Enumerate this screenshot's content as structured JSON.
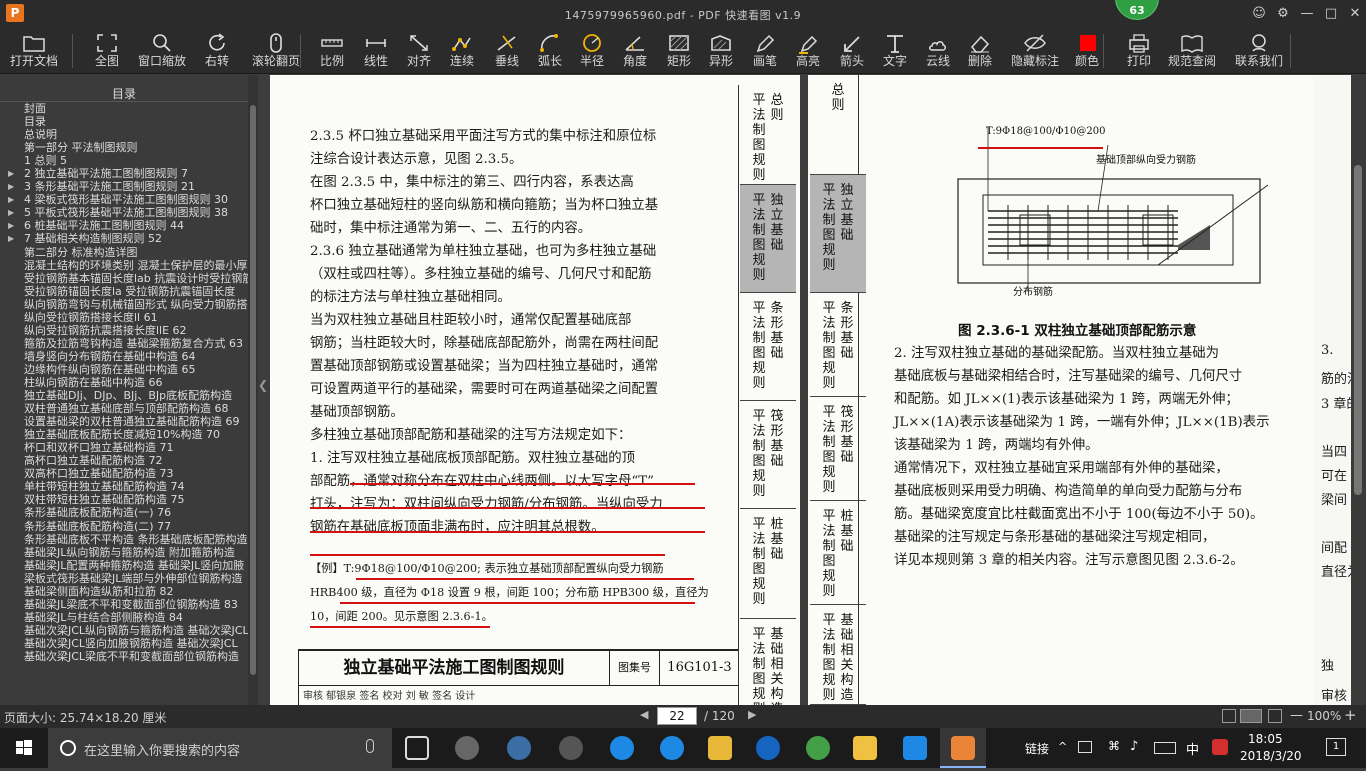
{
  "window": {
    "title": "1475979965960.pdf - PDF 快速看图 v1.9",
    "logo_letter": "P",
    "badge": "63"
  },
  "toolbar": [
    {
      "label": "打开文档",
      "icon": "folder-icon"
    },
    {
      "label": "全图",
      "icon": "fullscreen-icon"
    },
    {
      "label": "窗口缩放",
      "icon": "zoom-icon"
    },
    {
      "label": "右转",
      "icon": "rotate-right-icon"
    },
    {
      "label": "滚轮翻页",
      "icon": "mouse-icon"
    },
    {
      "label": "比例",
      "icon": "scale-icon"
    },
    {
      "label": "线性",
      "icon": "linear-icon"
    },
    {
      "label": "对齐",
      "icon": "align-icon"
    },
    {
      "label": "连续",
      "icon": "continuous-icon"
    },
    {
      "label": "垂线",
      "icon": "perpendicular-icon"
    },
    {
      "label": "弧长",
      "icon": "arc-icon"
    },
    {
      "label": "半径",
      "icon": "radius-icon"
    },
    {
      "label": "角度",
      "icon": "angle-icon"
    },
    {
      "label": "矩形",
      "icon": "rectangle-icon"
    },
    {
      "label": "异形",
      "icon": "irregular-icon"
    },
    {
      "label": "画笔",
      "icon": "pen-icon"
    },
    {
      "label": "高亮",
      "icon": "highlight-icon"
    },
    {
      "label": "箭头",
      "icon": "arrow-icon"
    },
    {
      "label": "文字",
      "icon": "text-icon"
    },
    {
      "label": "云线",
      "icon": "cloud-icon"
    },
    {
      "label": "删除",
      "icon": "eraser-icon"
    },
    {
      "label": "隐藏标注",
      "icon": "eye-hidden-icon"
    },
    {
      "label": "颜色",
      "icon": "color-swatch-icon",
      "color": "#ff0000"
    },
    {
      "label": "打印",
      "icon": "print-icon"
    },
    {
      "label": "规范查阅",
      "icon": "book-icon"
    },
    {
      "label": "联系我们",
      "icon": "contact-icon"
    }
  ],
  "sidebar": {
    "title": "目录",
    "items": [
      {
        "text": "封面",
        "expandable": false
      },
      {
        "text": "目录",
        "expandable": false
      },
      {
        "text": "总说明",
        "expandable": false
      },
      {
        "text": "第一部分  平法制图规则",
        "expandable": false
      },
      {
        "text": "1 总则 5",
        "expandable": false
      },
      {
        "text": "2 独立基础平法施工图制图规则 7",
        "expandable": true
      },
      {
        "text": "3 条形基础平法施工图制图规则 21",
        "expandable": true
      },
      {
        "text": "4 梁板式筏形基础平法施工图制图规则 30",
        "expandable": true
      },
      {
        "text": "5 平板式筏形基础平法施工图制图规则 38",
        "expandable": true
      },
      {
        "text": "6 桩基础平法施工图制图规则 44",
        "expandable": true
      },
      {
        "text": "7 基础相关构造制图规则 52",
        "expandable": true
      },
      {
        "text": "第二部分  标准构造详图",
        "expandable": false
      },
      {
        "text": "混凝土结构的环境类别 混凝土保护层的最小厚度",
        "expandable": false
      },
      {
        "text": "受拉钢筋基本锚固长度lab 抗震设计时受拉钢筋",
        "expandable": false
      },
      {
        "text": "受拉钢筋锚固长度la 受拉钢筋抗震锚固长度",
        "expandable": false
      },
      {
        "text": "纵向钢筋弯钩与机械锚固形式 纵向受力钢筋搭接",
        "expandable": false
      },
      {
        "text": "纵向受拉钢筋搭接长度ll 61",
        "expandable": false
      },
      {
        "text": "纵向受拉钢筋抗震搭接长度llE 62",
        "expandable": false
      },
      {
        "text": "箍筋及拉筋弯钩构造 基础梁箍筋复合方式 63",
        "expandable": false
      },
      {
        "text": "墙身竖向分布钢筋在基础中构造 64",
        "expandable": false
      },
      {
        "text": "边缘构件纵向钢筋在基础中构造 65",
        "expandable": false
      },
      {
        "text": "柱纵向钢筋在基础中构造 66",
        "expandable": false
      },
      {
        "text": "独立基础DJj、DJp、BJj、BJp底板配筋构造",
        "expandable": false
      },
      {
        "text": "双柱普通独立基础底部与顶部配筋构造 68",
        "expandable": false
      },
      {
        "text": "设置基础梁的双柱普通独立基础配筋构造 69",
        "expandable": false
      },
      {
        "text": "独立基础底板配筋长度减短10%构造 70",
        "expandable": false
      },
      {
        "text": "杯口和双杯口独立基础构造 71",
        "expandable": false
      },
      {
        "text": "高杯口独立基础配筋构造 72",
        "expandable": false
      },
      {
        "text": "双高杯口独立基础配筋构造 73",
        "expandable": false
      },
      {
        "text": "单柱带短柱独立基础配筋构造 74",
        "expandable": false
      },
      {
        "text": "双柱带短柱独立基础配筋构造 75",
        "expandable": false
      },
      {
        "text": "条形基础底板配筋构造(一) 76",
        "expandable": false
      },
      {
        "text": "条形基础底板配筋构造(二) 77",
        "expandable": false
      },
      {
        "text": "条形基础底板不平构造 条形基础底板配筋构造",
        "expandable": false
      },
      {
        "text": "基础梁JL纵向钢筋与箍筋构造 附加箍筋构造",
        "expandable": false
      },
      {
        "text": "基础梁JL配置两种箍筋构造 基础梁JL竖向加腋",
        "expandable": false
      },
      {
        "text": "梁板式筏形基础梁JL端部与外伸部位钢筋构造",
        "expandable": false
      },
      {
        "text": "基础梁侧面构造纵筋和拉筋 82",
        "expandable": false
      },
      {
        "text": "基础梁JL梁底不平和变截面部位钢筋构造 83",
        "expandable": false
      },
      {
        "text": "基础梁JL与柱结合部侧腋构造 84",
        "expandable": false
      },
      {
        "text": "基础次梁JCL纵向钢筋与箍筋构造 基础次梁JCL",
        "expandable": false
      },
      {
        "text": "基础次梁JCL竖向加腋钢筋构造 基础次梁JCL",
        "expandable": false
      },
      {
        "text": "基础次梁JCL梁底不平和变截面部位钢筋构造",
        "expandable": false
      }
    ]
  },
  "page_left": {
    "paragraphs": [
      "2.3.5 杯口独立基础采用平面注写方式的集中标注和原位标",
      "注综合设计表达示意，见图 2.3.5。",
      "    在图 2.3.5 中，集中标注的第三、四行内容，系表达高",
      "杯口独立基础短柱的竖向纵筋和横向箍筋；当为杯口独立基",
      "础时，集中标注通常为第一、二、五行的内容。",
      "2.3.6 独立基础通常为单柱独立基础，也可为多柱独立基础",
      "（双柱或四柱等）。多柱独立基础的编号、几何尺寸和配筋",
      "的标注方法与单柱独立基础相同。",
      "    当为双柱独立基础且柱距较小时，通常仅配置基础底部",
      "钢筋；当柱距较大时，除基础底部配筋外，尚需在两柱间配",
      "置基础顶部钢筋或设置基础梁；当为四柱独立基础时，通常",
      "可设置两道平行的基础梁，需要时可在两道基础梁之间配置",
      "基础顶部钢筋。",
      "    多柱独立基础顶部配筋和基础梁的注写方法规定如下：",
      "    1. 注写双柱独立基础底板顶部配筋。双柱独立基础的顶",
      "部配筋，通常对称分布在双柱中心线两侧。以大写字母“T”",
      "打头，注写为：双柱间纵向受力钢筋/分布钢筋。当纵向受力",
      "钢筋在基础底板顶面非满布时，应注明其总根数。"
    ],
    "example_lines": [
      "【例】T:9Φ18@100/Φ10@200; 表示独立基础顶部配置纵向受力钢筋",
      "HRB400 级，直径为 Φ18 设置 9 根，间距 100；分布筋 HPB300 级，直径为",
      "10，间距 200。见示意图 2.3.6-1。"
    ],
    "title_block": {
      "title": "独立基础平法施工图制图规则",
      "label": "图集号",
      "code": "16G101-3",
      "review_row": "审核 郁银泉 签名 校对 刘 敏 签名 设计"
    },
    "side_tabs": [
      "平法制图规则 总则",
      "平法制图规则 独立基础",
      "平法制图规则 条形基础",
      "平法制图规则 筏形基础",
      "平法制图规则 桩基础",
      "平法制图规则 基础相关构造"
    ]
  },
  "page_right": {
    "side_tabs": [
      "总则",
      "平法制图规则 独立基础",
      "平法制图规则 条形基础",
      "平法制图规则 筏形基础",
      "平法制图规则 桩基础",
      "平法制图规则 基础相关构造"
    ],
    "figure": {
      "label_top": "T:9Φ18@100/Φ10@200",
      "label_rebar": "基础顶部纵向受力钢筋",
      "label_dist": "分布钢筋",
      "caption": "图 2.3.6-1  双柱独立基础顶部配筋示意"
    },
    "paragraphs": [
      "    2. 注写双柱独立基础的基础梁配筋。当双柱独立基础为",
      "基础底板与基础梁相结合时，注写基础梁的编号、几何尺寸",
      "和配筋。如 JL××(1)表示该基础梁为 1 跨，两端无外伸；",
      "JL××(1A)表示该基础梁为 1 跨，一端有外伸；JL××(1B)表示",
      "该基础梁为 1 跨，两端均有外伸。",
      "    通常情况下，双柱独立基础宜采用端部有外伸的基础梁，",
      "基础底板则采用受力明确、构造简单的单向受力配筋与分布",
      "筋。基础梁宽度宜比柱截面宽出不小于 100(每边不小于 50)。",
      "    基础梁的注写规定与条形基础的基础梁注写规定相同，",
      "详见本规则第 3 章的相关内容。注写示意图见图 2.3.6-2。"
    ],
    "peek_lines": [
      "3.",
      "筋的注",
      "3 章的",
      "当四",
      "可在",
      "梁间",
      "间配",
      "直径为",
      "独",
      "审核"
    ]
  },
  "statusbar": {
    "page_size": "页面大小: 25.74×18.20 厘米",
    "current_page": "22",
    "total_pages": "/ 120",
    "zoom": "100%"
  },
  "taskbar": {
    "search_placeholder": "在这里输入你要搜索的内容",
    "tray_link": "链接",
    "ime": "中",
    "time": "18:05",
    "date": "2018/3/20",
    "notification_count": "1"
  }
}
